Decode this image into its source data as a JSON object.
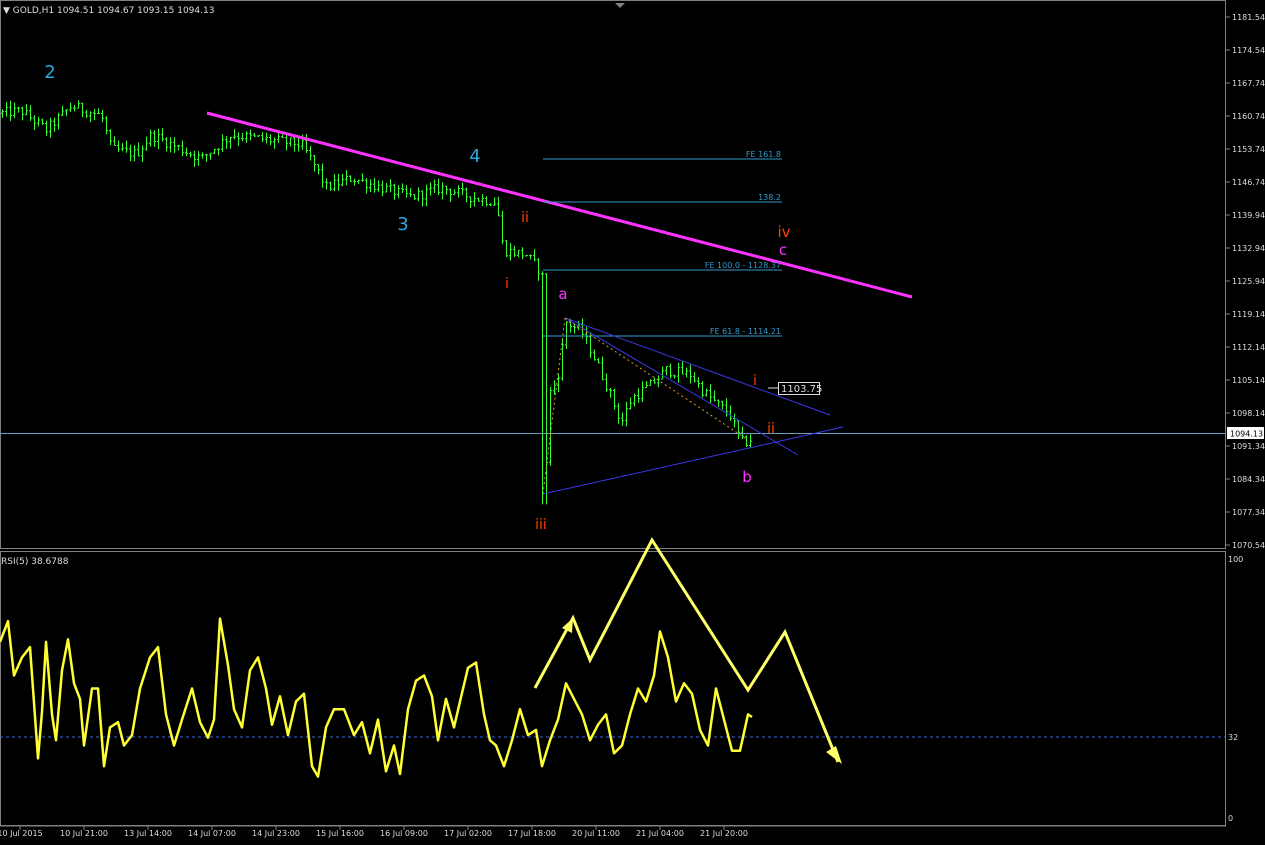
{
  "window": {
    "header": "▼ GOLD,H1  1094.51 1094.67 1093.15 1094.13",
    "rsi_header": "RSI(5) 38.6788"
  },
  "colors": {
    "background": "#000000",
    "bars": "#33ff33",
    "trendline": "#ff33ff",
    "fib": "#3399cc",
    "triangle": "#3a3ae8",
    "rsi": "#ffff33",
    "wave_blue": "#29a8e0",
    "wave_orange": "#ff4000",
    "wave_magenta": "#ff33ff",
    "current_price_line": "#6aa0c8"
  },
  "price_axis": {
    "labels": [
      "1181.54",
      "1174.54",
      "1167.74",
      "1160.74",
      "1153.74",
      "1146.74",
      "1139.94",
      "1132.94",
      "1125.94",
      "1119.14",
      "1112.14",
      "1105.14",
      "1098.14",
      "1091.34",
      "1084.34",
      "1077.34",
      "1070.54"
    ],
    "current_price": "1094.13",
    "marker_price": "1103.75"
  },
  "rsi_axis": {
    "labels": [
      "100",
      "32",
      "0"
    ]
  },
  "time_axis": {
    "labels": [
      "10 Jul 2015",
      "10 Jul 21:00",
      "13 Jul 14:00",
      "14 Jul 07:00",
      "14 Jul 23:00",
      "15 Jul 16:00",
      "16 Jul 09:00",
      "17 Jul 02:00",
      "17 Jul 18:00",
      "20 Jul 11:00",
      "21 Jul 04:00",
      "21 Jul 20:00"
    ]
  },
  "fibo": {
    "fe161": "FE 161.8",
    "fe138": "138.2",
    "fe100": "FE 100.0 - 1128.37",
    "fe61": "FE 61.8 - 1114.21"
  },
  "waves": {
    "w2": "2",
    "w3": "3",
    "w4": "4",
    "i1": "i",
    "ii1": "ii",
    "iii": "iii",
    "iv": "iv",
    "i2": "i",
    "ii2": "ii",
    "a": "a",
    "b": "b",
    "c": "c"
  },
  "chart_data": {
    "type": "line",
    "symbol": "GOLD",
    "timeframe": "H1",
    "ohlc_last": {
      "open": 1094.51,
      "high": 1094.67,
      "low": 1093.15,
      "close": 1094.13
    },
    "rsi_period": 5,
    "rsi_last": 38.6788,
    "rsi_level": 32,
    "ylim": [
      1070.54,
      1181.54
    ],
    "rsi_ylim": [
      0,
      100
    ],
    "fib_levels": [
      161.8,
      138.2,
      100.0,
      61.8
    ],
    "fib_prices": {
      "100.0": 1128.37,
      "61.8": 1114.21
    },
    "current_price": 1094.13,
    "marker_price": 1103.75
  }
}
